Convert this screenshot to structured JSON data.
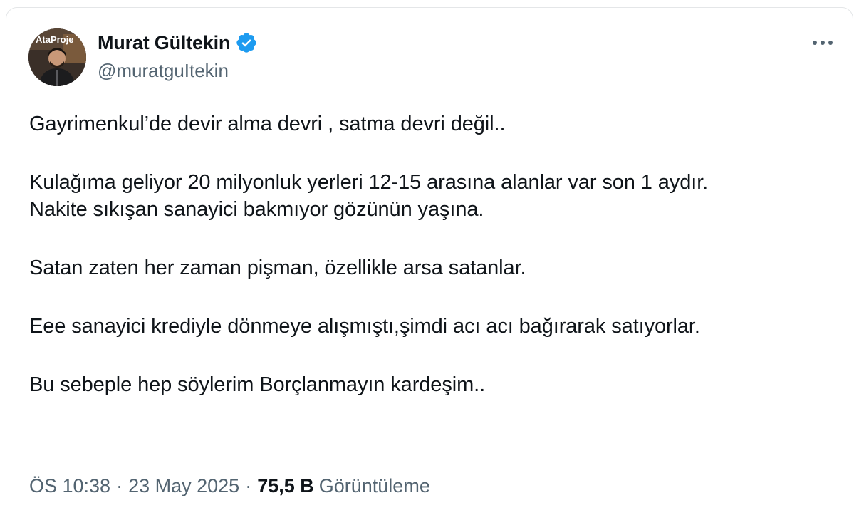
{
  "author": {
    "name": "Murat Gültekin",
    "handle": "@muratguItekin",
    "verified": true,
    "avatar_caption": "AtaProje"
  },
  "tweet": {
    "paragraphs": [
      [
        "Gayrimenkul’de devir alma devri , satma devri değil.."
      ],
      [
        "Kulağıma geliyor 20 milyonluk yerleri 12-15 arasına alanlar var son 1 aydır.",
        "Nakite sıkışan sanayici bakmıyor gözünün yaşına."
      ],
      [
        "Satan zaten her zaman pişman, özellikle arsa satanlar."
      ],
      [
        "Eee sanayici krediyle dönmeye alışmıştı,şimdi acı acı bağırarak satıyorlar."
      ],
      [
        "Bu sebeple hep söylerim Borçlanmayın kardeşim.."
      ]
    ]
  },
  "meta": {
    "time": "ÖS 10:38",
    "separator": "·",
    "date": "23 May 2025",
    "views_count": "75,5 B",
    "views_label": "Görüntüleme"
  },
  "colors": {
    "text": "#0f1419",
    "secondary": "#536471",
    "verified": "#1d9bf0",
    "border": "#e4e6e8"
  },
  "icons": {
    "verified": "verified-badge-icon",
    "more": "more-dots-icon"
  }
}
